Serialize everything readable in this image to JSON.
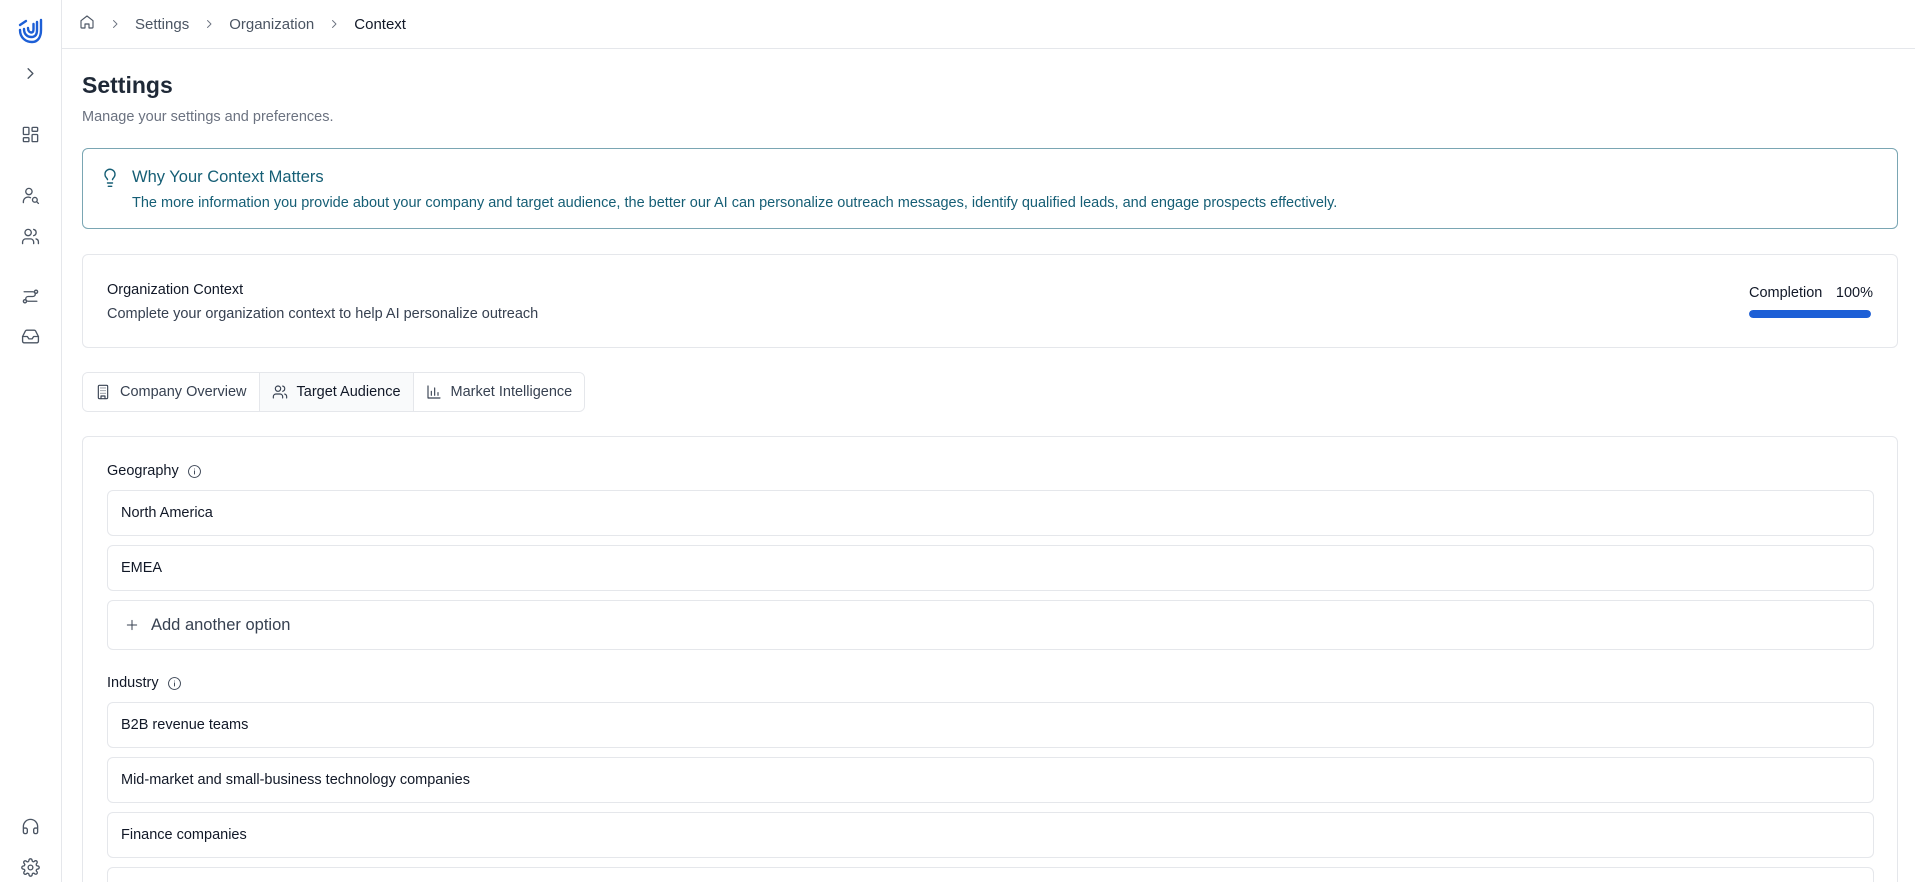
{
  "sidebar": {
    "logo": "brand-logo",
    "expand_icon": "chevron-right-icon",
    "items": [
      {
        "icon": "dashboard-icon"
      },
      {
        "icon": "user-search-icon"
      },
      {
        "icon": "users-icon"
      },
      {
        "icon": "workflow-icon"
      },
      {
        "icon": "inbox-icon"
      }
    ],
    "bottom": [
      {
        "icon": "headset-icon"
      },
      {
        "icon": "gear-icon"
      }
    ]
  },
  "breadcrumb": {
    "items": [
      "Settings",
      "Organization",
      "Context"
    ]
  },
  "header": {
    "title": "Settings",
    "subtitle": "Manage your settings and preferences."
  },
  "callout": {
    "title": "Why Your Context Matters",
    "text": "The more information you provide about your company and target audience, the better our AI can personalize outreach messages, identify qualified leads, and engage prospects effectively."
  },
  "org_context": {
    "title": "Organization Context",
    "subtitle": "Complete your organization context to help AI personalize outreach",
    "completion_label": "Completion",
    "completion_value": "100%",
    "completion_fraction": 1.0
  },
  "tabs": [
    {
      "label": "Company Overview",
      "icon": "building-icon",
      "active": false
    },
    {
      "label": "Target Audience",
      "icon": "users-icon",
      "active": true
    },
    {
      "label": "Market Intelligence",
      "icon": "bar-chart-icon",
      "active": false
    }
  ],
  "form": {
    "geography": {
      "label": "Geography",
      "options": [
        "North America",
        "EMEA"
      ],
      "add_label": "Add another option"
    },
    "industry": {
      "label": "Industry",
      "options": [
        "B2B revenue teams",
        "Mid-market and small-business technology companies",
        "Finance companies"
      ]
    }
  },
  "colors": {
    "accent": "#1d5fd6",
    "callout_text": "#155e75",
    "callout_border": "#7aa6b3"
  }
}
